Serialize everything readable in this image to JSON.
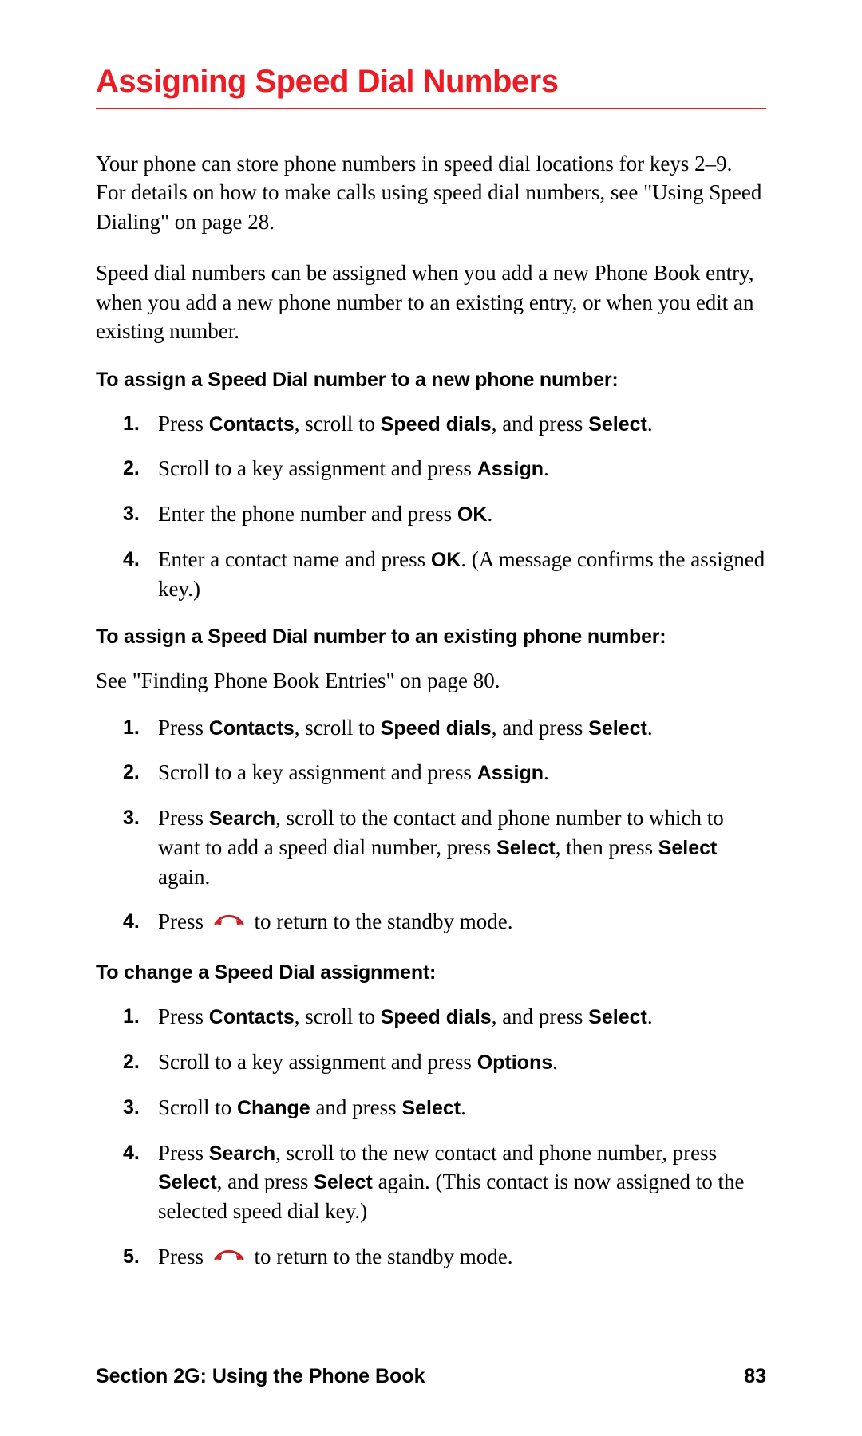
{
  "title": "Assigning Speed Dial Numbers",
  "intro_paragraphs": [
    "Your phone can store phone numbers in speed dial locations for keys 2–9. For details on how to make calls using speed dial numbers, see \"Using Speed Dialing\" on page 28.",
    "Speed dial numbers can be assigned when you add a new Phone Book entry, when you add a new phone number to an existing entry, or when you edit an existing number."
  ],
  "sections": [
    {
      "heading": "To assign a Speed Dial number to a new phone number:",
      "note_before": null,
      "steps": [
        [
          {
            "t": "Press "
          },
          {
            "b": "Contacts"
          },
          {
            "t": ", scroll to "
          },
          {
            "b": "Speed dials"
          },
          {
            "t": ", and press "
          },
          {
            "b": "Select"
          },
          {
            "t": "."
          }
        ],
        [
          {
            "t": "Scroll to a key assignment and press "
          },
          {
            "b": "Assign"
          },
          {
            "t": "."
          }
        ],
        [
          {
            "t": "Enter the phone number and press "
          },
          {
            "b": "OK"
          },
          {
            "t": "."
          }
        ],
        [
          {
            "t": "Enter a contact name and press "
          },
          {
            "b": "OK"
          },
          {
            "t": ". (A message confirms the assigned key.)"
          }
        ]
      ]
    },
    {
      "heading": "To assign a Speed Dial number to an existing phone number:",
      "note_before": "See \"Finding Phone Book Entries\" on page 80.",
      "steps": [
        [
          {
            "t": "Press "
          },
          {
            "b": "Contacts"
          },
          {
            "t": ", scroll to "
          },
          {
            "b": "Speed dials"
          },
          {
            "t": ", and press "
          },
          {
            "b": "Select"
          },
          {
            "t": "."
          }
        ],
        [
          {
            "t": "Scroll to a key assignment and press "
          },
          {
            "b": "Assign"
          },
          {
            "t": "."
          }
        ],
        [
          {
            "t": "Press "
          },
          {
            "b": "Search"
          },
          {
            "t": ", scroll to the contact and phone number to which to want to add a speed dial number, press "
          },
          {
            "b": "Select"
          },
          {
            "t": ", then press "
          },
          {
            "b": "Select"
          },
          {
            "t": " again."
          }
        ],
        [
          {
            "t": "Press "
          },
          {
            "icon": "end-call-icon"
          },
          {
            "t": " to return to the standby mode."
          }
        ]
      ]
    },
    {
      "heading": "To change a Speed Dial assignment:",
      "note_before": null,
      "steps": [
        [
          {
            "t": "Press "
          },
          {
            "b": "Contacts"
          },
          {
            "t": ", scroll to "
          },
          {
            "b": "Speed dials"
          },
          {
            "t": ", and press "
          },
          {
            "b": "Select"
          },
          {
            "t": "."
          }
        ],
        [
          {
            "t": "Scroll to a key assignment and press "
          },
          {
            "b": "Options"
          },
          {
            "t": "."
          }
        ],
        [
          {
            "t": "Scroll to "
          },
          {
            "b": "Change"
          },
          {
            "t": " and press "
          },
          {
            "b": "Select"
          },
          {
            "t": "."
          }
        ],
        [
          {
            "t": "Press "
          },
          {
            "b": "Search"
          },
          {
            "t": ", scroll to the new contact and phone number, press "
          },
          {
            "b": "Select"
          },
          {
            "t": ", and press "
          },
          {
            "b": "Select"
          },
          {
            "t": " again. (This contact is now assigned to the selected speed dial key.)"
          }
        ],
        [
          {
            "t": "Press "
          },
          {
            "icon": "end-call-icon"
          },
          {
            "t": " to return to the standby mode."
          }
        ]
      ]
    }
  ],
  "footer": {
    "section_label": "Section 2G: Using the Phone Book",
    "page_number": "83"
  }
}
